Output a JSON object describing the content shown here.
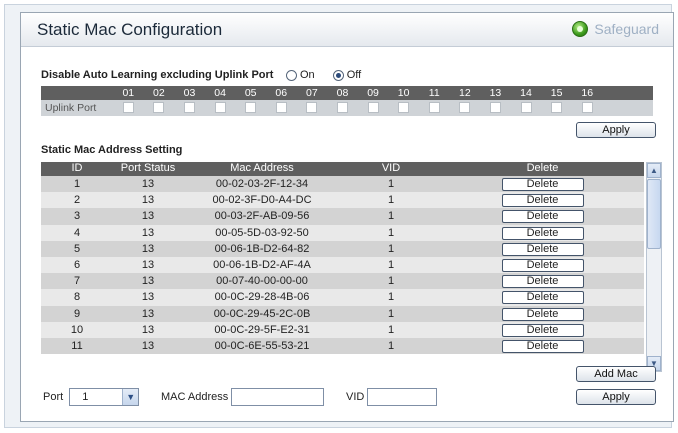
{
  "header": {
    "title": "Static Mac Configuration",
    "badge": "Safeguard"
  },
  "auto_learning": {
    "label": "Disable Auto Learning excluding Uplink Port",
    "options": [
      {
        "label": "On",
        "checked": false
      },
      {
        "label": "Off",
        "checked": true
      }
    ],
    "row_label": "Uplink Port",
    "ports": [
      "01",
      "02",
      "03",
      "04",
      "05",
      "06",
      "07",
      "08",
      "09",
      "10",
      "11",
      "12",
      "13",
      "14",
      "15",
      "16"
    ],
    "apply_label": "Apply"
  },
  "static_mac": {
    "label": "Static Mac Address Setting",
    "columns": [
      "ID",
      "Port Status",
      "Mac Address",
      "VID",
      "Delete"
    ],
    "rows": [
      {
        "id": "1",
        "port": "13",
        "mac": "00-02-03-2F-12-34",
        "vid": "1",
        "action": "Delete"
      },
      {
        "id": "2",
        "port": "13",
        "mac": "00-02-3F-D0-A4-DC",
        "vid": "1",
        "action": "Delete"
      },
      {
        "id": "3",
        "port": "13",
        "mac": "00-03-2F-AB-09-56",
        "vid": "1",
        "action": "Delete"
      },
      {
        "id": "4",
        "port": "13",
        "mac": "00-05-5D-03-92-50",
        "vid": "1",
        "action": "Delete"
      },
      {
        "id": "5",
        "port": "13",
        "mac": "00-06-1B-D2-64-82",
        "vid": "1",
        "action": "Delete"
      },
      {
        "id": "6",
        "port": "13",
        "mac": "00-06-1B-D2-AF-4A",
        "vid": "1",
        "action": "Delete"
      },
      {
        "id": "7",
        "port": "13",
        "mac": "00-07-40-00-00-00",
        "vid": "1",
        "action": "Delete"
      },
      {
        "id": "8",
        "port": "13",
        "mac": "00-0C-29-28-4B-06",
        "vid": "1",
        "action": "Delete"
      },
      {
        "id": "9",
        "port": "13",
        "mac": "00-0C-29-45-2C-0B",
        "vid": "1",
        "action": "Delete"
      },
      {
        "id": "10",
        "port": "13",
        "mac": "00-0C-29-5F-E2-31",
        "vid": "1",
        "action": "Delete"
      },
      {
        "id": "11",
        "port": "13",
        "mac": "00-0C-6E-55-53-21",
        "vid": "1",
        "action": "Delete"
      }
    ]
  },
  "form": {
    "add_mac_label": "Add Mac",
    "apply_label": "Apply",
    "port_label": "Port",
    "port_value": "1",
    "mac_label": "MAC Address",
    "mac_value": "",
    "vid_label": "VID",
    "vid_value": ""
  }
}
